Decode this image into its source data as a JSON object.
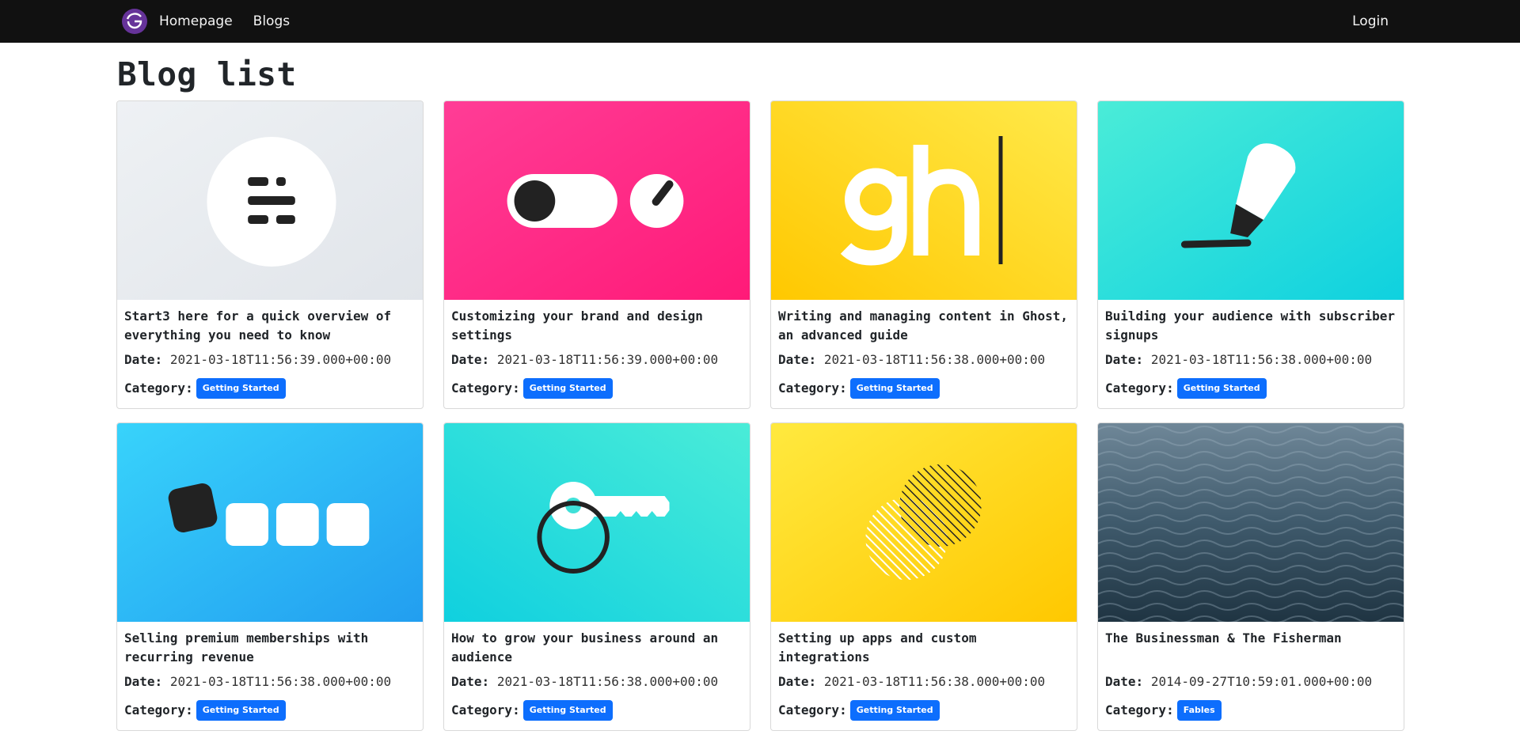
{
  "nav": {
    "logo_icon": "gatsby-logo-icon",
    "links": [
      "Homepage",
      "Blogs"
    ],
    "login": "Login",
    "accent": "#663399"
  },
  "page": {
    "title": "Blog list"
  },
  "labels": {
    "date": "Date:",
    "category": "Category:"
  },
  "posts": [
    {
      "title": "Start3 here for a quick overview of everything you need to know",
      "date": "2021-03-18T11:56:39.000+00:00",
      "category": "Getting Started",
      "image": "overview-icon-on-grey"
    },
    {
      "title": "Customizing your brand and design settings",
      "date": "2021-03-18T11:56:39.000+00:00",
      "category": "Getting Started",
      "image": "toggle-and-dial-on-pink"
    },
    {
      "title": "Writing and managing content in Ghost, an advanced guide",
      "date": "2021-03-18T11:56:38.000+00:00",
      "category": "Getting Started",
      "image": "gh-logo-on-yellow"
    },
    {
      "title": "Building your audience with subscriber signups",
      "date": "2021-03-18T11:56:38.000+00:00",
      "category": "Getting Started",
      "image": "marker-pen-on-teal"
    },
    {
      "title": "Selling premium memberships with recurring revenue",
      "date": "2021-03-18T11:56:38.000+00:00",
      "category": "Getting Started",
      "image": "squares-on-blue"
    },
    {
      "title": "How to grow your business around an audience",
      "date": "2021-03-18T11:56:38.000+00:00",
      "category": "Getting Started",
      "image": "key-and-ring-on-teal"
    },
    {
      "title": "Setting up apps and custom integrations",
      "date": "2021-03-18T11:56:38.000+00:00",
      "category": "Getting Started",
      "image": "overlapping-circles-on-yellow"
    },
    {
      "title": "The Businessman & The Fisherman",
      "date": "2014-09-27T10:59:01.000+00:00",
      "category": "Fables",
      "image": "ocean-water-photo"
    }
  ]
}
